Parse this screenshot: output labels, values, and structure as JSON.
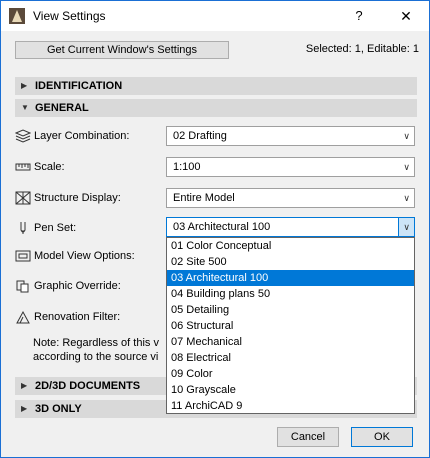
{
  "window": {
    "title": "View Settings",
    "help_label": "?",
    "close_label": "✕"
  },
  "toolbar": {
    "get_settings_label": "Get Current Window's Settings",
    "selected_info": "Selected: 1, Editable: 1"
  },
  "sections": {
    "identification": {
      "label": "IDENTIFICATION",
      "arrow": "▶"
    },
    "general": {
      "label": "GENERAL",
      "arrow": "▼"
    },
    "documents": {
      "label": "2D/3D DOCUMENTS",
      "arrow": "▶"
    },
    "three_d": {
      "label": "3D ONLY",
      "arrow": "▶"
    }
  },
  "general": {
    "layer_combination": {
      "label": "Layer Combination:",
      "value": "02 Drafting",
      "icon": "layers-icon"
    },
    "scale": {
      "label": "Scale:",
      "value": "1:100",
      "icon": "ruler-icon"
    },
    "structure_display": {
      "label": "Structure Display:",
      "value": "Entire Model",
      "icon": "structure-icon"
    },
    "pen_set": {
      "label": "Pen Set:",
      "value": "03 Architectural 100",
      "icon": "pen-icon"
    },
    "model_view_options": {
      "label": "Model View Options:",
      "icon": "model-view-icon"
    },
    "graphic_override": {
      "label": "Graphic Override:",
      "icon": "graphic-override-icon"
    },
    "renovation_filter": {
      "label": "Renovation Filter:",
      "icon": "renovation-icon"
    },
    "note_line1": "Note: Regardless of this v",
    "note_line2": "according to the source vi"
  },
  "pen_set_options": [
    "01 Color Conceptual",
    "02 Site 500",
    "03 Architectural 100",
    "04 Building plans 50",
    "05 Detailing",
    "06 Structural",
    "07 Mechanical",
    "08 Electrical",
    "09 Color",
    "10 Grayscale",
    "11 ArchiCAD 9"
  ],
  "pen_set_selected_index": 2,
  "buttons": {
    "cancel": "Cancel",
    "ok": "OK"
  },
  "colors": {
    "accent": "#0078d7",
    "section_bg": "#d9d9d9",
    "window_border": "#1a6fd4"
  }
}
